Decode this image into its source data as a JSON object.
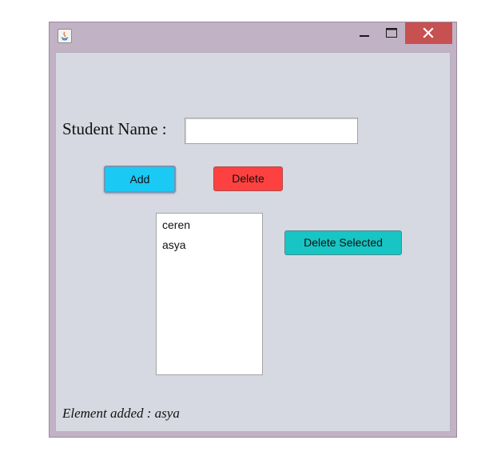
{
  "window": {
    "title": "",
    "controls": {
      "minimize_icon": "minimize-icon",
      "maximize_icon": "maximize-icon",
      "close_icon": "close-icon"
    },
    "app_icon": "java-icon",
    "close_color": "#c75050"
  },
  "form": {
    "name_label": "Student Name :",
    "name_value": "",
    "add_label": "Add",
    "delete_label": "Delete",
    "delete_selected_label": "Delete Selected"
  },
  "students": [
    "ceren",
    "asya"
  ],
  "status": {
    "text": "Element added : asya"
  },
  "colors": {
    "add_button": "#1bc9f5",
    "delete_button": "#fc4140",
    "delete_selected_button": "#17c5c5",
    "panel_background": "#d6d9e1",
    "frame": "#c2b2c5"
  }
}
